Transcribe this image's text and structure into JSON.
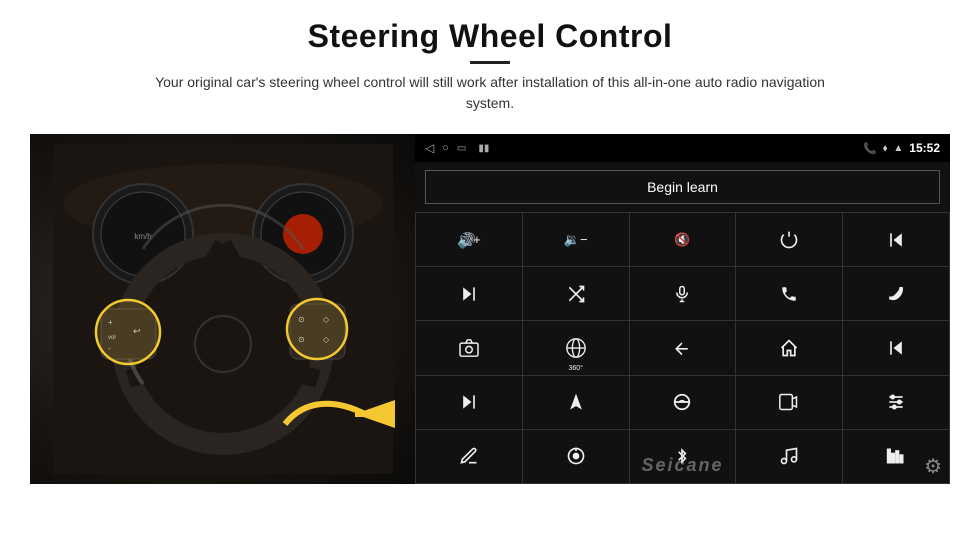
{
  "header": {
    "title": "Steering Wheel Control",
    "subtitle": "Your original car's steering wheel control will still work after installation of this all-in-one auto radio navigation system.",
    "divider": true
  },
  "status_bar": {
    "back_icon": "◁",
    "home_icon": "□",
    "recent_icon": "▭",
    "signal_icon": "▮▮",
    "phone_icon": "📞",
    "location_icon": "◉",
    "wifi_icon": "▲",
    "time": "15:52"
  },
  "controls": {
    "begin_learn_label": "Begin learn",
    "grid": [
      {
        "id": "vol-up",
        "icon": "vol_up"
      },
      {
        "id": "vol-down",
        "icon": "vol_down"
      },
      {
        "id": "mute",
        "icon": "mute"
      },
      {
        "id": "power",
        "icon": "power"
      },
      {
        "id": "prev-track",
        "icon": "prev_track"
      },
      {
        "id": "next",
        "icon": "next"
      },
      {
        "id": "shuffle",
        "icon": "shuffle"
      },
      {
        "id": "mic",
        "icon": "mic"
      },
      {
        "id": "phone",
        "icon": "phone"
      },
      {
        "id": "hangup",
        "icon": "hangup"
      },
      {
        "id": "camera",
        "icon": "camera"
      },
      {
        "id": "view360",
        "icon": "360"
      },
      {
        "id": "back",
        "icon": "back"
      },
      {
        "id": "home",
        "icon": "home"
      },
      {
        "id": "skipback",
        "icon": "skipback"
      },
      {
        "id": "skipfwd",
        "icon": "skipfwd"
      },
      {
        "id": "navigate",
        "icon": "navigate"
      },
      {
        "id": "eq",
        "icon": "eq"
      },
      {
        "id": "record",
        "icon": "record"
      },
      {
        "id": "settings",
        "icon": "settings"
      },
      {
        "id": "pen",
        "icon": "pen"
      },
      {
        "id": "knob",
        "icon": "knob"
      },
      {
        "id": "bluetooth",
        "icon": "bluetooth"
      },
      {
        "id": "music",
        "icon": "music"
      },
      {
        "id": "bar",
        "icon": "bar"
      }
    ]
  },
  "watermark": "Seicane",
  "gear_icon": "⚙"
}
